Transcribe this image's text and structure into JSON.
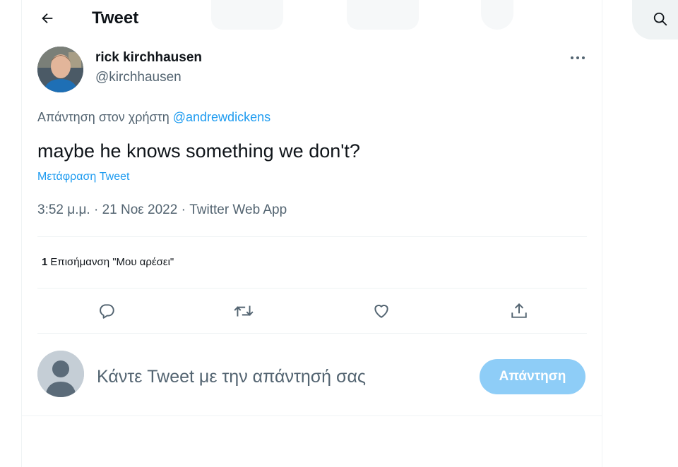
{
  "header": {
    "title": "Tweet",
    "back_icon": "arrow-left-icon"
  },
  "tweet": {
    "author": {
      "name": "rick kirchhausen",
      "handle": "@kirchhausen"
    },
    "more_icon": "more-icon",
    "reply_to": {
      "prefix": "Απάντηση στον χρήστη",
      "mention": "@andrewdickens"
    },
    "text": "maybe he knows something we don't?",
    "translate_label": "Μετάφραση Tweet",
    "meta": "3:52 μ.μ. · 21 Νοε 2022 · Twitter Web App",
    "stats": {
      "likes_count": "1",
      "likes_label": "Επισήμανση \"Μου αρέσει\""
    },
    "actions": [
      "reply-icon",
      "retweet-icon",
      "like-icon",
      "share-icon"
    ]
  },
  "reply_box": {
    "placeholder": "Κάντε Tweet με την απάντησή σας",
    "button_label": "Απάντηση"
  },
  "search": {
    "icon": "search-icon"
  },
  "colors": {
    "accent": "#1d9bf0",
    "reply_button": "#8ecdf7",
    "secondary_text": "#536471",
    "divider": "#eff3f4"
  }
}
